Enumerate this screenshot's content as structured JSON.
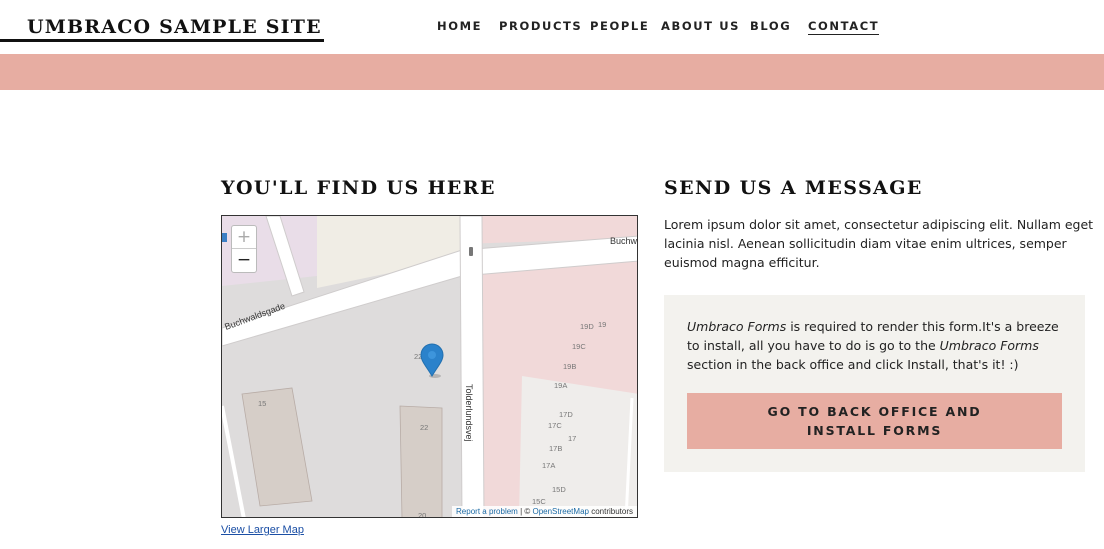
{
  "site": {
    "logo": "UMBRACO SAMPLE SITE"
  },
  "nav": {
    "items": [
      {
        "label": "HOME",
        "active": false
      },
      {
        "label": "PRODUCTS",
        "active": false
      },
      {
        "label": "PEOPLE",
        "active": false
      },
      {
        "label": "ABOUT US",
        "active": false
      },
      {
        "label": "BLOG",
        "active": false
      },
      {
        "label": "CONTACT",
        "active": true
      }
    ]
  },
  "colors": {
    "accent": "#e7ada2",
    "form_bg": "#f3f2ee",
    "text": "#222222"
  },
  "location": {
    "title": "YOU'LL FIND US HERE",
    "map": {
      "zoom_in": "+",
      "zoom_out": "−",
      "streets": [
        "Buchwaldsgade",
        "Buchw",
        "Tolderlundsvej"
      ],
      "house_numbers": [
        "22",
        "15",
        "22",
        "20",
        "19D",
        "19",
        "19C",
        "19B",
        "19A",
        "17D",
        "17C",
        "17",
        "17B",
        "17A",
        "15D",
        "15C"
      ],
      "marker_icon": "map-pin-icon",
      "attribution": {
        "report": "Report a problem",
        "sep": " | © ",
        "osm": "OpenStreetMap",
        "contrib": " contributors"
      }
    },
    "link": "View Larger Map"
  },
  "message": {
    "title": "SEND US A MESSAGE",
    "body": "Lorem ipsum dolor sit amet, consectetur adipiscing elit. Nullam eget lacinia nisl. Aenean sollicitudin diam vitae enim ultrices, semper euismod magna efficitur.",
    "form": {
      "em1": "Umbraco Forms",
      "t1": " is required to render this form.It's a breeze to install, all you have to do is go to the ",
      "em2": "Umbraco Forms",
      "t2": " section in the back office and click Install, that's it! :)",
      "button": "GO TO BACK OFFICE AND INSTALL FORMS"
    }
  }
}
